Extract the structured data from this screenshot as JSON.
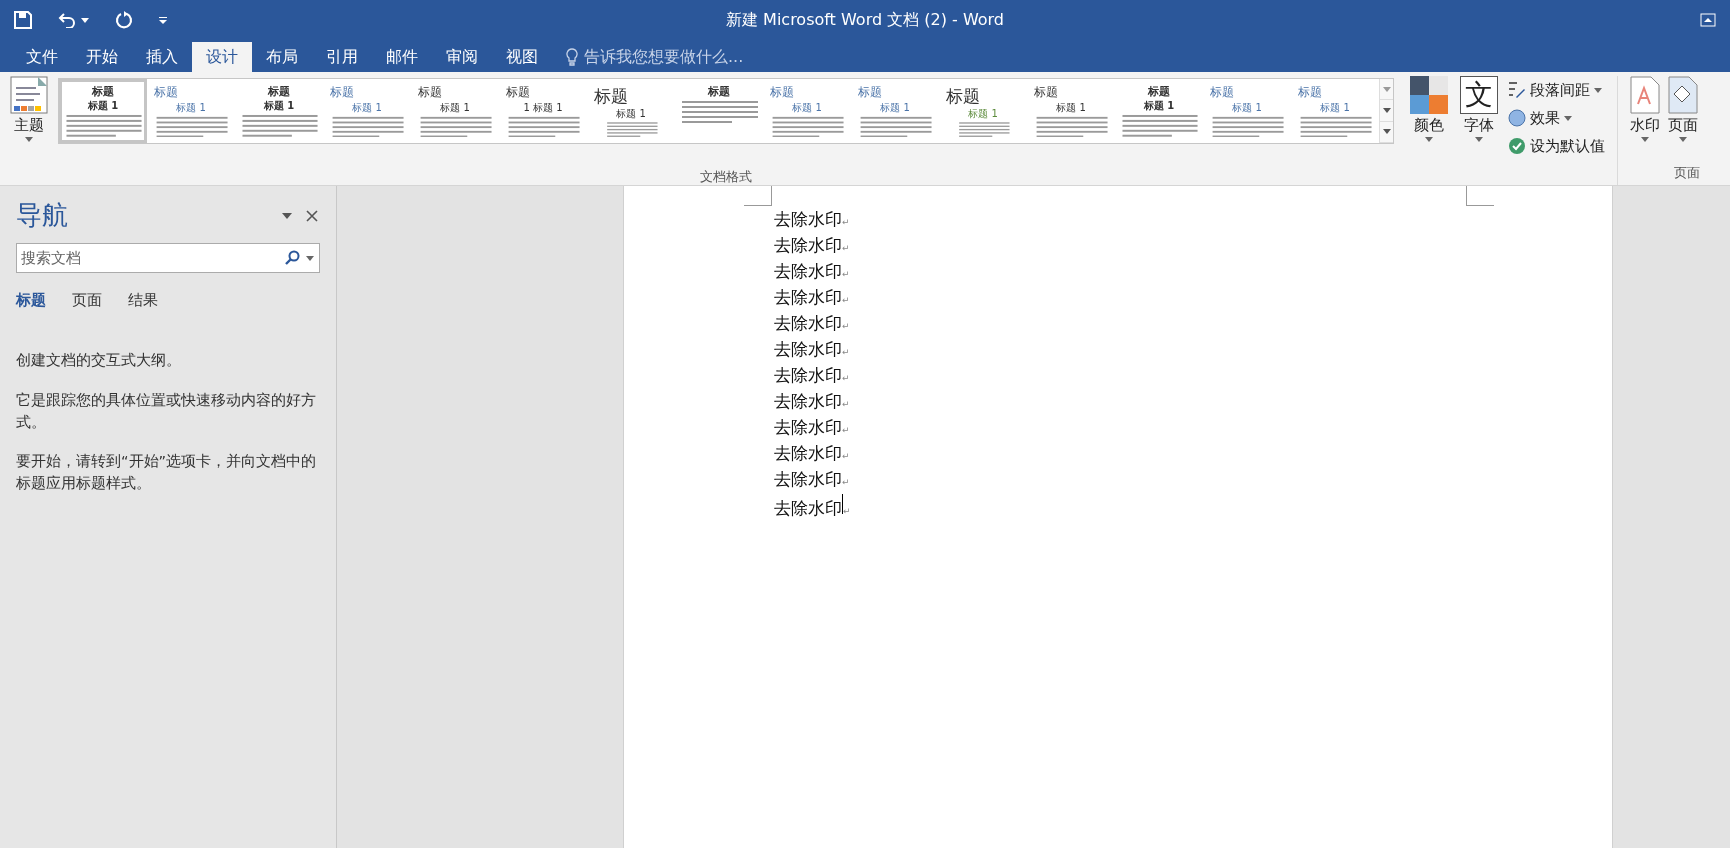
{
  "window": {
    "title": "新建 Microsoft Word 文档 (2) - Word"
  },
  "ribbon_tabs": [
    {
      "label": "文件",
      "selected": false
    },
    {
      "label": "开始",
      "selected": false
    },
    {
      "label": "插入",
      "selected": false
    },
    {
      "label": "设计",
      "selected": true
    },
    {
      "label": "布局",
      "selected": false
    },
    {
      "label": "引用",
      "selected": false
    },
    {
      "label": "邮件",
      "selected": false
    },
    {
      "label": "审阅",
      "selected": false
    },
    {
      "label": "视图",
      "selected": false
    }
  ],
  "tell_me": {
    "placeholder": "告诉我您想要做什么..."
  },
  "theme_button": {
    "label": "主题"
  },
  "style_gallery": {
    "label": "文档格式",
    "items": [
      {
        "title": "标题",
        "heading": "标题 1",
        "selected": true,
        "kind": "center"
      },
      {
        "title": "标题",
        "heading": "标题 1",
        "selected": false,
        "kind": "blue"
      },
      {
        "title": "标题",
        "heading": "标题 1",
        "selected": false,
        "kind": "center"
      },
      {
        "title": "标题",
        "heading": "标题 1",
        "selected": false,
        "kind": "blue"
      },
      {
        "title": "标题",
        "heading": "标题 1",
        "selected": false,
        "kind": "plain"
      },
      {
        "title": "标题",
        "heading": "1 标题 1",
        "selected": false,
        "kind": "plain"
      },
      {
        "title": "标题",
        "heading": "标题 1",
        "selected": false,
        "kind": "large"
      },
      {
        "title": "标题",
        "selected": false,
        "kind": "center"
      },
      {
        "title": "标题",
        "heading": "标题 1",
        "selected": false,
        "kind": "blue"
      },
      {
        "title": "标题",
        "heading": "标题 1",
        "selected": false,
        "kind": "blue"
      },
      {
        "title": "标题",
        "heading": "标题 1",
        "selected": false,
        "kind": "green"
      },
      {
        "title": "标题",
        "heading": "标题 1",
        "selected": false,
        "kind": "plain"
      },
      {
        "title": "标题",
        "heading": "标题 1",
        "selected": false,
        "kind": "center"
      },
      {
        "title": "标题",
        "heading": "标题 1",
        "selected": false,
        "kind": "blue"
      },
      {
        "title": "标题",
        "heading": "标题 1",
        "selected": false,
        "kind": "blue"
      }
    ]
  },
  "colors_button": {
    "label": "颜色"
  },
  "fonts_button": {
    "label": "字体",
    "glyph": "文"
  },
  "paragraph_spacing": {
    "label": "段落间距"
  },
  "effects": {
    "label": "效果"
  },
  "set_default": {
    "label": "设为默认值"
  },
  "watermark_button": {
    "label": "水印"
  },
  "page_color_button": {
    "label": "页面"
  },
  "page_background_group": {
    "label": "页面"
  },
  "navigation": {
    "title": "导航",
    "search": {
      "placeholder": "搜索文档"
    },
    "tabs": [
      {
        "label": "标题",
        "selected": true
      },
      {
        "label": "页面",
        "selected": false
      },
      {
        "label": "结果",
        "selected": false
      }
    ],
    "paragraphs": [
      "创建文档的交互式大纲。",
      "它是跟踪您的具体位置或快速移动内容的好方式。",
      "要开始，请转到“开始”选项卡，并向文档中的标题应用标题样式。"
    ]
  },
  "document": {
    "lines": [
      {
        "text": "去除水印",
        "mark": "↵",
        "cursor": false
      },
      {
        "text": "去除水印",
        "mark": "↵",
        "cursor": false
      },
      {
        "text": "去除水印",
        "mark": "↵",
        "cursor": false
      },
      {
        "text": "去除水印",
        "mark": "↵",
        "cursor": false
      },
      {
        "text": "去除水印",
        "mark": "↵",
        "cursor": false
      },
      {
        "text": "去除水印",
        "mark": "↵",
        "cursor": false
      },
      {
        "text": "去除水印",
        "mark": "↵",
        "cursor": false
      },
      {
        "text": "去除水印",
        "mark": "↵",
        "cursor": false
      },
      {
        "text": "去除水印",
        "mark": "↵",
        "cursor": false
      },
      {
        "text": "去除水印",
        "mark": "↵",
        "cursor": false
      },
      {
        "text": "去除水印",
        "mark": "↵",
        "cursor": false
      },
      {
        "text": "去除水印",
        "mark": "↵",
        "cursor": true
      }
    ]
  }
}
